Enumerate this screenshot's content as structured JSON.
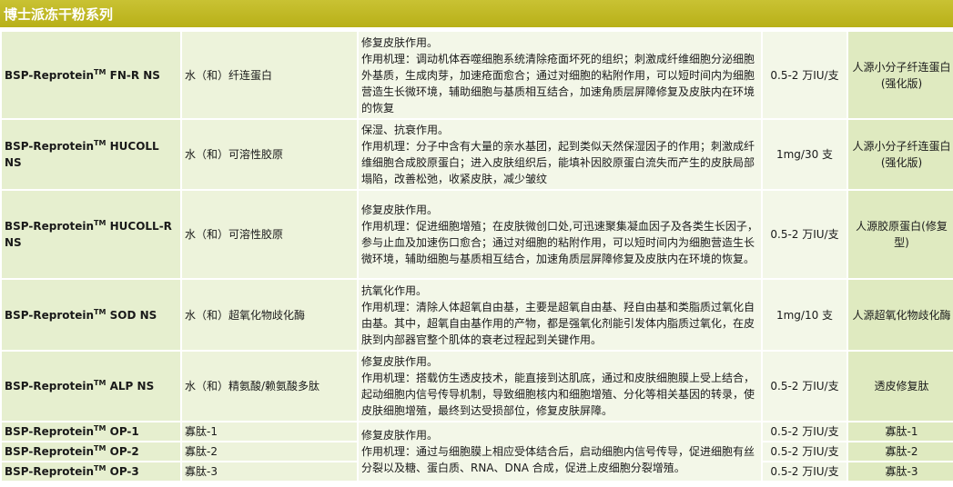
{
  "title": "博士派冻干粉系列",
  "tm": "TM",
  "rows": [
    {
      "name_prefix": "BSP-Reprotein",
      "name_suffix": " FN-R NS",
      "ingredient": "水（和）纤连蛋白",
      "desc_title": "修复皮肤作用。",
      "desc_body": "作用机理：调动机体吞噬细胞系统清除疮面坏死的组织；刺激成纤维细胞分泌细胞外基质，生成肉芽，加速疮面愈合；通过对细胞的粘附作用，可以短时间内为细胞营造生长微环境，辅助细胞与基质相互结合，加速角质层屏障修复及皮肤内在环境的恢复",
      "dosage": "0.5-2 万IU/支",
      "type": "人源小分子纤连蛋白(强化版)"
    },
    {
      "name_prefix": "BSP-Reprotein",
      "name_suffix": " HUCOLL NS",
      "ingredient": "水（和）可溶性胶原",
      "desc_title": "保湿、抗衰作用。",
      "desc_body": "作用机理：分子中含有大量的亲水基团，起到类似天然保湿因子的作用；刺激成纤维细胞合成胶原蛋白；进入皮肤组织后，能填补因胶原蛋白流失而产生的皮肤局部塌陷，改善松弛，收紧皮肤，减少皱纹",
      "dosage": "1mg/30 支",
      "type": "人源小分子纤连蛋白(强化版)"
    },
    {
      "name_prefix": "BSP-Reprotein",
      "name_suffix": " HUCOLL-R NS",
      "ingredient": "水（和）可溶性胶原",
      "desc_title": "修复皮肤作用。",
      "desc_body": "作用机理：促进细胞增殖；在皮肤微创口处,可迅速聚集凝血因子及各类生长因子，参与止血及加速伤口愈合；通过对细胞的粘附作用，可以短时间内为细胞营造生长微环境，辅助细胞与基质相互结合，加速角质层屏障修复及皮肤内在环境的恢复。",
      "dosage": "0.5-2 万IU/支",
      "type": "人源胶原蛋白(修复型)"
    },
    {
      "name_prefix": "BSP-Reprotein",
      "name_suffix": " SOD NS",
      "ingredient": "水（和）超氧化物歧化酶",
      "desc_title": "抗氧化作用。",
      "desc_body": "作用机理：清除人体超氧自由基，主要是超氧自由基、羟自由基和类脂质过氧化自由基。其中，超氧自由基作用的产物，都是强氧化剂能引发体内脂质过氧化，在皮肤到内部器官整个肌体的衰老过程起到关键作用。",
      "dosage": "1mg/10 支",
      "type": "人源超氧化物歧化酶"
    },
    {
      "name_prefix": "BSP-Reprotein",
      "name_suffix": " ALP NS",
      "ingredient": "水（和）精氨酸/赖氨酸多肽",
      "desc_title": "修复皮肤作用。",
      "desc_body": "作用机理：搭载仿生透皮技术，能直接到达肌底，通过和皮肤细胞膜上受上结合，起动细胞内信号传导机制，导致细胞核内和细胞增殖、分化等相关基因的转录，使皮肤细胞增殖，最终到达受损部位，修复皮肤屏障。",
      "dosage": "0.5-2 万IU/支",
      "type": "透皮修复肽"
    }
  ],
  "op_rows": [
    {
      "name_prefix": "BSP-Reprotein",
      "name_suffix": " OP-1",
      "ingredient": "寡肽-1",
      "dosage": "0.5-2 万IU/支",
      "type": "寡肽-1"
    },
    {
      "name_prefix": "BSP-Reprotein",
      "name_suffix": " OP-2",
      "ingredient": "寡肽-2",
      "dosage": "0.5-2 万IU/支",
      "type": "寡肽-2"
    },
    {
      "name_prefix": "BSP-Reprotein",
      "name_suffix": " OP-3",
      "ingredient": "寡肽-3",
      "dosage": "0.5-2 万IU/支",
      "type": "寡肽-3"
    }
  ],
  "op_desc_title": "修复皮肤作用。",
  "op_desc_body": "作用机理：通过与细胞膜上相应受体结合后，启动细胞内信号传导，促进细胞有丝分裂以及糖、蛋白质、RNA、DNA 合成，促进上皮细胞分裂增殖。"
}
